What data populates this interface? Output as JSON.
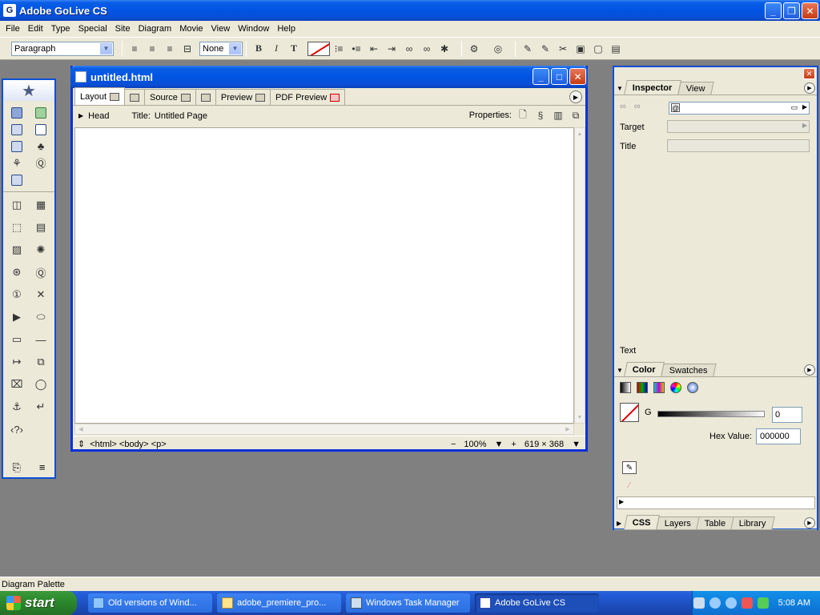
{
  "window": {
    "title": "Adobe GoLive CS"
  },
  "menu": [
    "File",
    "Edit",
    "Type",
    "Special",
    "Site",
    "Diagram",
    "Movie",
    "View",
    "Window",
    "Help"
  ],
  "toolbar": {
    "paragraph_format": "Paragraph",
    "font_set": "None",
    "bold": "B",
    "italic": "I",
    "teletype": "T"
  },
  "document": {
    "title": "untitled.html",
    "tabs": [
      "Layout",
      "Source",
      "Preview",
      "PDF Preview"
    ],
    "head_label": "Head",
    "title_label": "Title:",
    "page_title": "Untitled Page",
    "properties_label": "Properties:",
    "status_path": "<html> <body> <p>",
    "zoom": "100%",
    "window_size": "619 × 368"
  },
  "inspector": {
    "tabs": [
      "Inspector",
      "View"
    ],
    "target_label": "Target",
    "title_label": "Title",
    "text_label": "Text"
  },
  "color_panel": {
    "tabs": [
      "Color",
      "Swatches"
    ],
    "channel_label": "G",
    "channel_value": "0",
    "hex_label": "Hex Value:",
    "hex_value": "000000"
  },
  "bottom_tabs": [
    "CSS",
    "Layers",
    "Table",
    "Library"
  ],
  "app_status": "Diagram Palette",
  "taskbar": {
    "start_label": "start",
    "tasks": [
      "Old versions of Wind...",
      "adobe_premiere_pro...",
      "Windows Task Manager",
      "Adobe GoLive CS"
    ],
    "clock": "5:08 AM"
  }
}
